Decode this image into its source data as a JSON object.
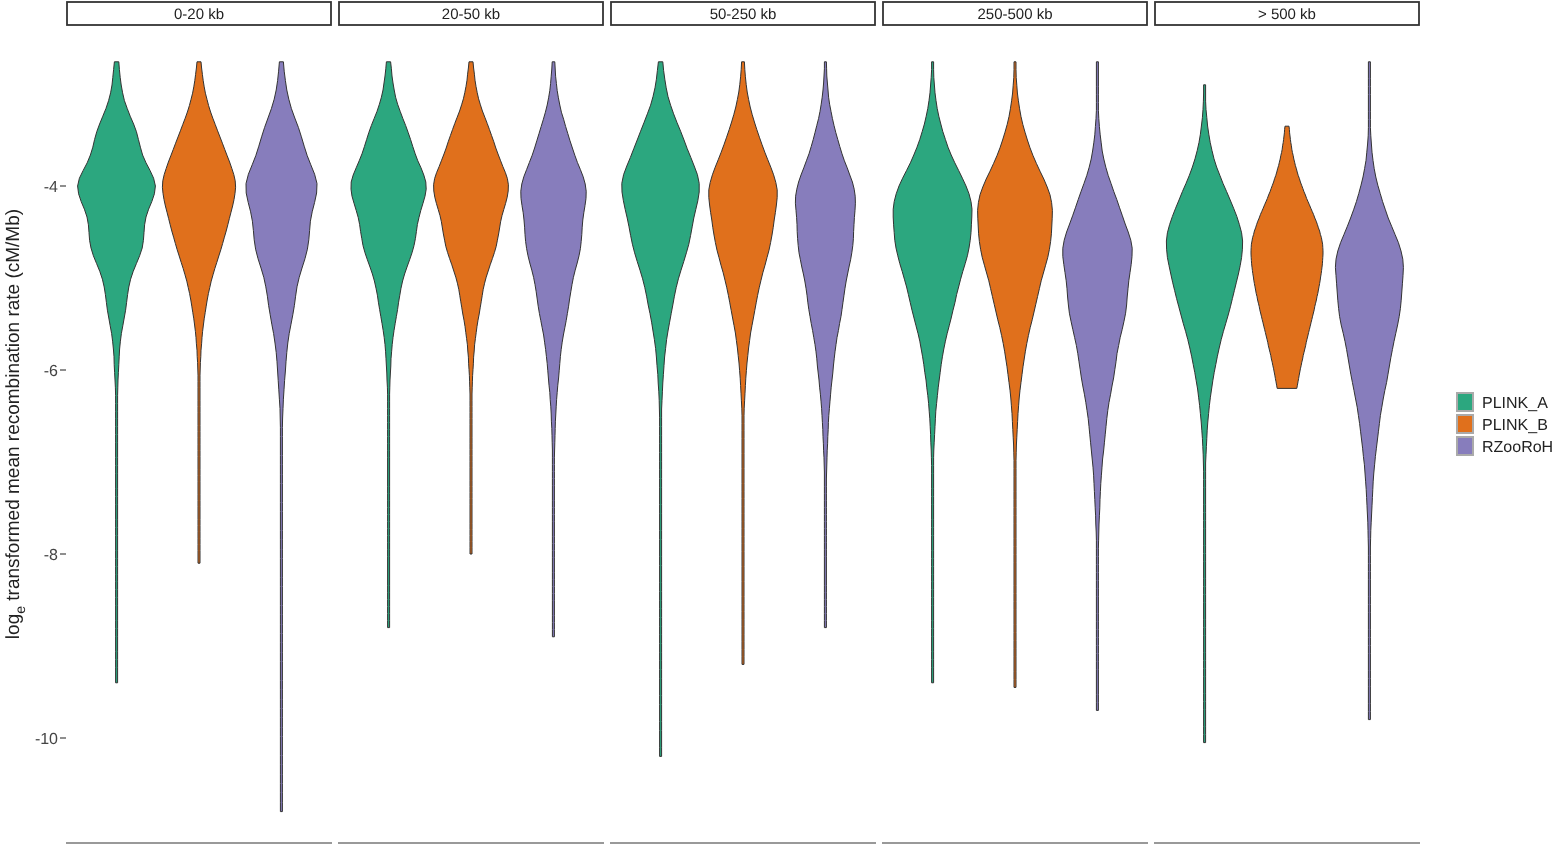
{
  "chart": {
    "ylabel": "log$_{e}$ transformed mean recombination rate (cM/Mb)",
    "yticks": [
      "-4",
      "-6",
      "-8",
      "-10"
    ],
    "panels": [
      {
        "label": "0-20 kb"
      },
      {
        "label": "20-50 kb"
      },
      {
        "label": "50-250 kb"
      },
      {
        "label": "250-500 kb"
      },
      {
        "label": "> 500 kb"
      }
    ]
  },
  "legend": [
    {
      "label": "PLINK_A",
      "color": "#2ca77f"
    },
    {
      "label": "PLINK_B",
      "color": "#e0701c"
    },
    {
      "label": "RZooRoH",
      "color": "#877dbc"
    }
  ]
}
